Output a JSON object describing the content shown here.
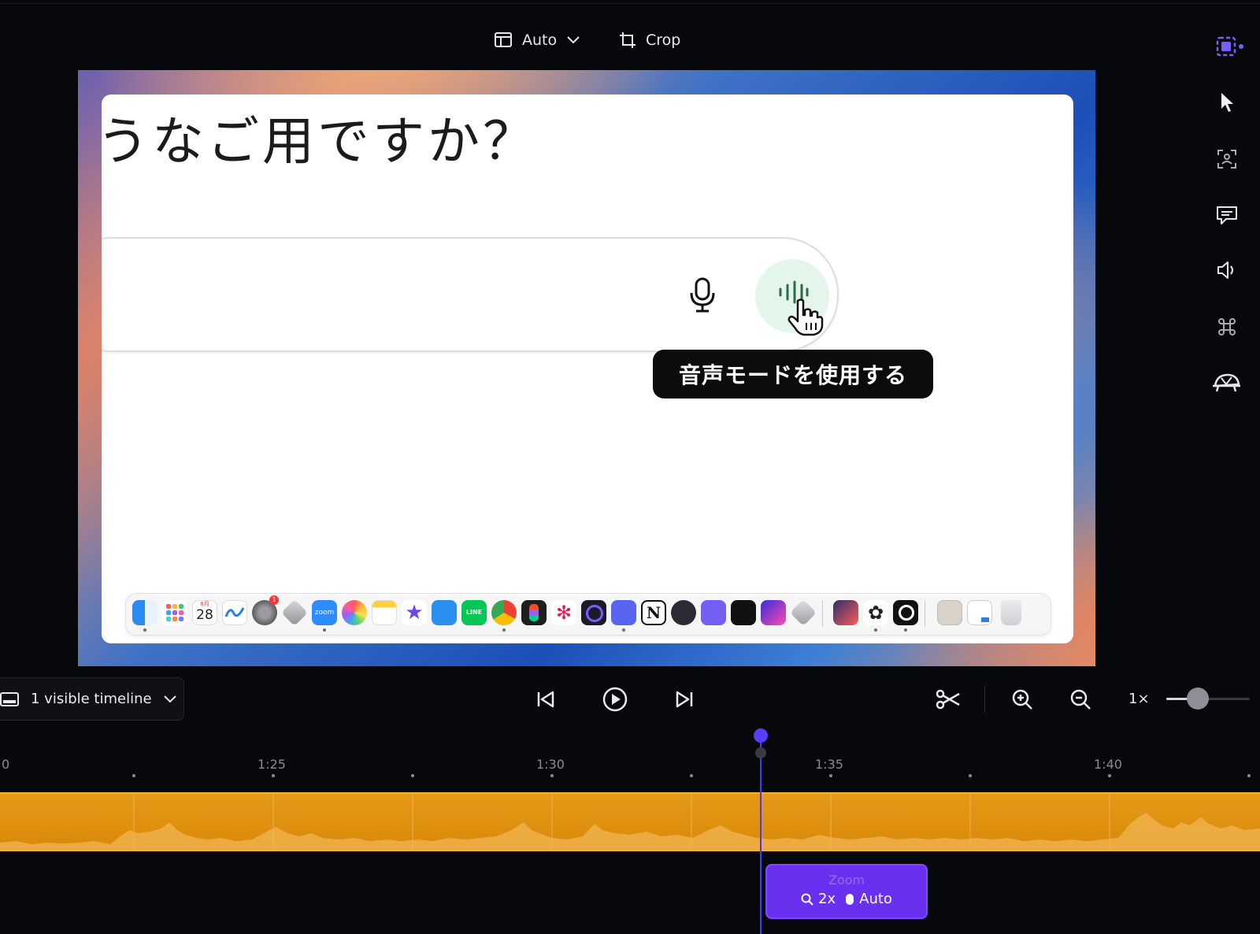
{
  "toolbar": {
    "layout_label": "Auto",
    "crop_label": "Crop"
  },
  "preview": {
    "heading": "うなご用ですか？",
    "tooltip": "音声モードを使用する",
    "calendar_month": "8月",
    "calendar_day": "28",
    "zoom_app_label": "zoom",
    "line_app_label": "LINE",
    "notion_letter": "N",
    "notification_count": "1"
  },
  "timeline": {
    "visible_label": "1 visible timeline",
    "speed_label": "1×",
    "ruler_labels": [
      "0",
      "1:25",
      "1:30",
      "1:35",
      "1:40"
    ],
    "zoom_block": {
      "title": "Zoom",
      "scale": "2x",
      "mode": "Auto"
    }
  },
  "colors": {
    "accent": "#6a30f0",
    "playhead": "#5a3cff",
    "audio_track": "#e09214",
    "voice_bg": "#e4f5ec",
    "voice_icon": "#2f6b47"
  },
  "icons": [
    "layout-icon",
    "chevron-down-icon",
    "crop-icon",
    "screen-select-icon",
    "cursor-icon",
    "face-scan-icon",
    "caption-icon",
    "speaker-icon",
    "command-icon",
    "turtle-icon",
    "monitor-icon",
    "skip-back-icon",
    "play-icon",
    "skip-forward-icon",
    "scissors-icon",
    "zoom-in-icon",
    "zoom-out-icon",
    "microphone-icon",
    "voice-wave-icon",
    "hand-cursor-icon",
    "search-icon",
    "mouse-icon"
  ]
}
